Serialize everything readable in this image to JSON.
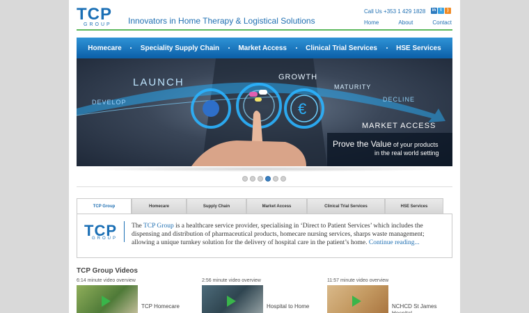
{
  "header": {
    "logo": "TCP",
    "logo_sub": "GROUP",
    "tagline": "Innovators in Home Therapy & Logistical Solutions",
    "call_label": "Call Us",
    "phone": "+353 1 429 1828",
    "links": [
      "Home",
      "About",
      "Contact"
    ],
    "social_icons": [
      "linkedin-icon",
      "twitter-icon",
      "rss-icon"
    ]
  },
  "nav": {
    "items": [
      "Homecare",
      "Speciality Supply Chain",
      "Market Access",
      "Clinical Trial Services",
      "HSE Services"
    ]
  },
  "banner": {
    "launch": "LAUNCH",
    "develop": "DEVELOP",
    "growth": "GROWTH",
    "maturity": "MATURITY",
    "decline": "DECLINE",
    "market_access": "MARKET ACCESS",
    "caption_prefix": "Prove the Value",
    "caption_suffix": " of your products",
    "caption_line2": "in the real world setting"
  },
  "slider": {
    "count": 6,
    "active_index": 3
  },
  "tabs": {
    "labels": [
      "TCP Group",
      "Homecare",
      "Supply Chain",
      "Market Access",
      "Clinical Trial Services",
      "HSE Services"
    ],
    "active": 0
  },
  "panel": {
    "logo": "TCP",
    "logo_sub": "GROUP",
    "text_before": "The ",
    "link": "TCP Group",
    "text_after": " is a healthcare service provider, specialising in ‘Direct to Patient Services’ which includes the dispensing and distribution of pharmaceutical products, homecare nursing services, sharps waste management; allowing a unique turnkey solution for the delivery of hospital care in the patient’s home. ",
    "more": "Continue reading..."
  },
  "videos": {
    "title": "TCP Group Videos",
    "items": [
      {
        "length": "6:14 minute video overview",
        "title": "TCP Homecare"
      },
      {
        "length": "2:56 minute video overview",
        "title": "Hospital to Home"
      },
      {
        "length": "11:57 minute video overview",
        "title": "NCHCD St James Hospital"
      }
    ]
  },
  "colors": {
    "brand_blue": "#1a6fb5",
    "nav_blue": "#0b5fa8",
    "accent_green": "#5cb85c",
    "play_green": "#39b54a"
  }
}
